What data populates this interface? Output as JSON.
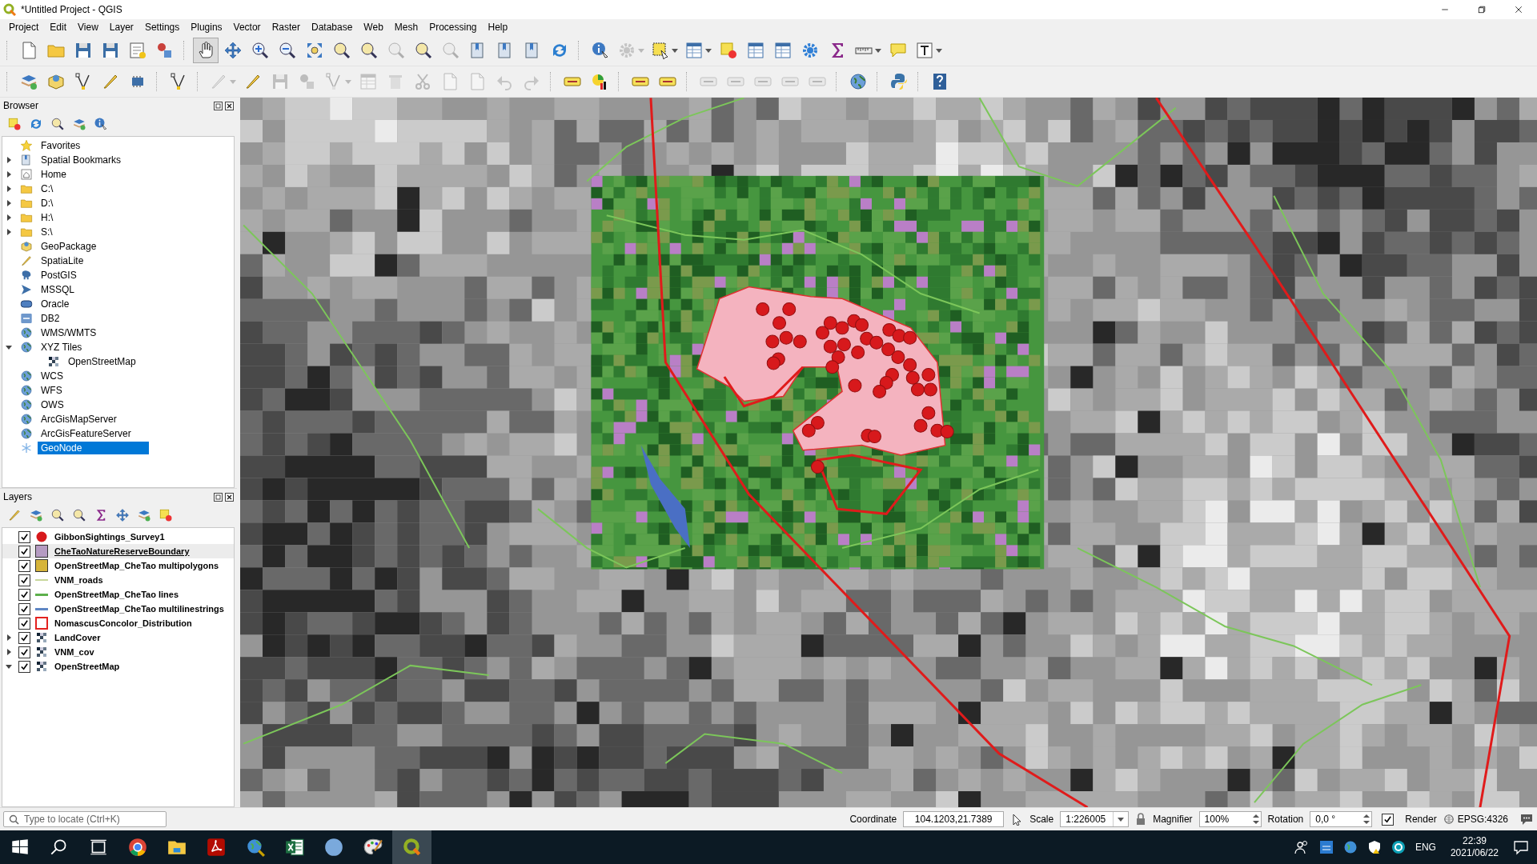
{
  "window": {
    "title": "*Untitled Project - QGIS"
  },
  "menu": [
    "Project",
    "Edit",
    "View",
    "Layer",
    "Settings",
    "Plugins",
    "Vector",
    "Raster",
    "Database",
    "Web",
    "Mesh",
    "Processing",
    "Help"
  ],
  "toolbars": [
    [
      [
        {
          "kind": "doc",
          "disabled": false
        },
        {
          "kind": "folder",
          "disabled": false
        },
        {
          "kind": "disk",
          "disabled": false
        },
        {
          "kind": "disk",
          "disabled": false
        },
        {
          "kind": "layout",
          "disabled": false
        },
        {
          "kind": "shapes",
          "disabled": false
        }
      ],
      [
        {
          "kind": "hand",
          "disabled": false,
          "selected": true
        },
        {
          "kind": "arrows",
          "disabled": false,
          "selected": false
        },
        {
          "kind": "zoomin",
          "disabled": false,
          "selected": false
        },
        {
          "kind": "zoomout",
          "disabled": false,
          "selected": false
        },
        {
          "kind": "expand",
          "disabled": false,
          "selected": false
        },
        {
          "kind": "magnifier",
          "disabled": false,
          "selected": false
        },
        {
          "kind": "magnifier",
          "disabled": false,
          "selected": false
        },
        {
          "kind": "magnifier",
          "disabled": true,
          "selected": false
        },
        {
          "kind": "magnifier",
          "disabled": false,
          "selected": false
        },
        {
          "kind": "magnifier",
          "disabled": true,
          "selected": false
        },
        {
          "kind": "bookmark",
          "disabled": false,
          "selected": false
        },
        {
          "kind": "bookmark",
          "disabled": false,
          "selected": false
        },
        {
          "kind": "bookmark",
          "disabled": false,
          "selected": false
        },
        {
          "kind": "refresh",
          "disabled": false,
          "selected": false
        }
      ],
      [
        {
          "kind": "info",
          "disabled": false
        },
        {
          "kind": "gear",
          "disabled": true,
          "caret": true
        },
        {
          "kind": "select",
          "disabled": false,
          "caret": true
        },
        {
          "kind": "table",
          "disabled": false,
          "caret": true
        },
        {
          "kind": "square",
          "disabled": false
        },
        {
          "kind": "table",
          "disabled": false
        },
        {
          "kind": "table",
          "disabled": false
        },
        {
          "kind": "gear",
          "disabled": false
        },
        {
          "kind": "sigma",
          "disabled": false
        },
        {
          "kind": "ruler",
          "disabled": false,
          "caret": true
        },
        {
          "kind": "bubble",
          "disabled": false
        },
        {
          "kind": "textbox",
          "disabled": false,
          "caret": true
        }
      ]
    ],
    [
      [
        {
          "kind": "layers",
          "disabled": false
        },
        {
          "kind": "package",
          "disabled": false
        },
        {
          "kind": "vertex",
          "disabled": false
        },
        {
          "kind": "pencil",
          "disabled": false
        },
        {
          "kind": "chip",
          "disabled": false
        }
      ],
      [
        {
          "kind": "vertex",
          "disabled": false
        }
      ],
      [
        {
          "kind": "pencil",
          "disabled": true,
          "caret": true
        },
        {
          "kind": "pencil",
          "disabled": false
        },
        {
          "kind": "disk",
          "disabled": true
        },
        {
          "kind": "shapes",
          "disabled": true
        },
        {
          "kind": "vertex",
          "disabled": true,
          "caret": true
        },
        {
          "kind": "table",
          "disabled": true
        },
        {
          "kind": "trash",
          "disabled": true
        },
        {
          "kind": "scissors",
          "disabled": true
        },
        {
          "kind": "doc",
          "disabled": true
        },
        {
          "kind": "doc",
          "disabled": true
        },
        {
          "kind": "undo",
          "disabled": true
        },
        {
          "kind": "redo",
          "disabled": true
        }
      ],
      [
        {
          "kind": "label",
          "disabled": false
        },
        {
          "kind": "chart",
          "disabled": false
        }
      ],
      [
        {
          "kind": "label",
          "disabled": false
        },
        {
          "kind": "label",
          "disabled": false
        }
      ],
      [
        {
          "kind": "label",
          "disabled": true
        },
        {
          "kind": "label",
          "disabled": true
        },
        {
          "kind": "label",
          "disabled": true
        },
        {
          "kind": "label",
          "disabled": true
        },
        {
          "kind": "label",
          "disabled": true
        }
      ],
      [
        {
          "kind": "globe",
          "disabled": false
        }
      ],
      [
        {
          "kind": "python",
          "disabled": false
        }
      ],
      [
        {
          "kind": "help",
          "disabled": false
        }
      ]
    ]
  ],
  "browser": {
    "title": "Browser",
    "items": [
      {
        "label": "Favorites",
        "kind": "star",
        "selected": false
      },
      {
        "label": "Spatial Bookmarks",
        "kind": "bookmark",
        "expanded": false,
        "selected": false
      },
      {
        "label": "Home",
        "kind": "home",
        "expanded": false,
        "selected": false
      },
      {
        "label": "C:\\",
        "kind": "folder",
        "expanded": false,
        "selected": false
      },
      {
        "label": "D:\\",
        "kind": "folder",
        "expanded": false,
        "selected": false
      },
      {
        "label": "H:\\",
        "kind": "folder",
        "expanded": false,
        "selected": false
      },
      {
        "label": "S:\\",
        "kind": "folder",
        "expanded": false,
        "selected": false
      },
      {
        "label": "GeoPackage",
        "kind": "package",
        "selected": false
      },
      {
        "label": "SpatiaLite",
        "kind": "pencil",
        "selected": false
      },
      {
        "label": "PostGIS",
        "kind": "elephant",
        "selected": false
      },
      {
        "label": "MSSQL",
        "kind": "fish",
        "selected": false
      },
      {
        "label": "Oracle",
        "kind": "pill",
        "selected": false
      },
      {
        "label": "DB2",
        "kind": "db",
        "selected": false
      },
      {
        "label": "WMS/WMTS",
        "kind": "globe",
        "selected": false
      },
      {
        "label": "XYZ Tiles",
        "kind": "globe",
        "expanded": true,
        "selected": false,
        "children": [
          {
            "label": "OpenStreetMap",
            "kind": "raster",
            "selected": false
          }
        ]
      },
      {
        "label": "WCS",
        "kind": "globe",
        "selected": false
      },
      {
        "label": "WFS",
        "kind": "globe",
        "selected": false
      },
      {
        "label": "OWS",
        "kind": "globe",
        "selected": false
      },
      {
        "label": "ArcGisMapServer",
        "kind": "globe",
        "selected": false
      },
      {
        "label": "ArcGisFeatureServer",
        "kind": "globe",
        "selected": false
      },
      {
        "label": "GeoNode",
        "kind": "node",
        "selected": true
      }
    ]
  },
  "layers": {
    "title": "Layers",
    "items": [
      {
        "label": "GibbonSightings_Survey1",
        "checked": true,
        "selected": false,
        "symbol": {
          "kind": "dot",
          "color": "#d7191c"
        }
      },
      {
        "label": "CheTaoNatureReserveBoundary",
        "checked": true,
        "selected": true,
        "symbol": {
          "kind": "fill",
          "color": "#b59bc2"
        }
      },
      {
        "label": "OpenStreetMap_CheTao multipolygons",
        "checked": true,
        "selected": false,
        "symbol": {
          "kind": "fill",
          "color": "#d6b43a"
        }
      },
      {
        "label": "VNM_roads",
        "checked": true,
        "selected": false,
        "symbol": {
          "kind": "thinline",
          "color": "#c7d79a"
        }
      },
      {
        "label": "OpenStreetMap_CheTao lines",
        "checked": true,
        "selected": false,
        "symbol": {
          "kind": "line",
          "color": "#5db04c"
        }
      },
      {
        "label": "OpenStreetMap_CheTao multilinestrings",
        "checked": true,
        "selected": false,
        "symbol": {
          "kind": "line",
          "color": "#5f86c4"
        }
      },
      {
        "label": "NomascusConcolor_Distribution",
        "checked": true,
        "selected": false,
        "symbol": {
          "kind": "outline",
          "color": "#e3221f"
        }
      },
      {
        "label": "LandCover",
        "checked": true,
        "selected": false,
        "expanded": false,
        "symbol": {
          "kind": "raster"
        }
      },
      {
        "label": "VNM_cov",
        "checked": true,
        "selected": false,
        "expanded": false,
        "symbol": {
          "kind": "raster"
        }
      },
      {
        "label": "OpenStreetMap",
        "checked": true,
        "selected": false,
        "expanded": true,
        "symbol": {
          "kind": "raster"
        }
      }
    ]
  },
  "status_bar": {
    "locator": {
      "placeholder": "Type to locate (Ctrl+K)"
    },
    "coordinate_label": "Coordinate",
    "coordinate": "104.1203,21.7389",
    "scale_label": "Scale",
    "scale": "1:226005",
    "magnifier_label": "Magnifier",
    "magnifier": "100%",
    "rotation_label": "Rotation",
    "rotation": "0,0 °",
    "render": {
      "label": "Render",
      "checked": true
    },
    "crs": "EPSG:4326"
  },
  "taskbar": {
    "apps": [
      {
        "kind": "chrome",
        "selected": false
      },
      {
        "kind": "explorer",
        "selected": false
      },
      {
        "kind": "pdf",
        "selected": false
      },
      {
        "kind": "globe",
        "selected": false
      },
      {
        "kind": "excel",
        "selected": false
      },
      {
        "kind": "r",
        "selected": false
      },
      {
        "kind": "paint",
        "selected": false
      },
      {
        "kind": "qgis",
        "selected": true
      }
    ],
    "language": "ENG",
    "time": "22:39",
    "date": "2021/06/22"
  }
}
